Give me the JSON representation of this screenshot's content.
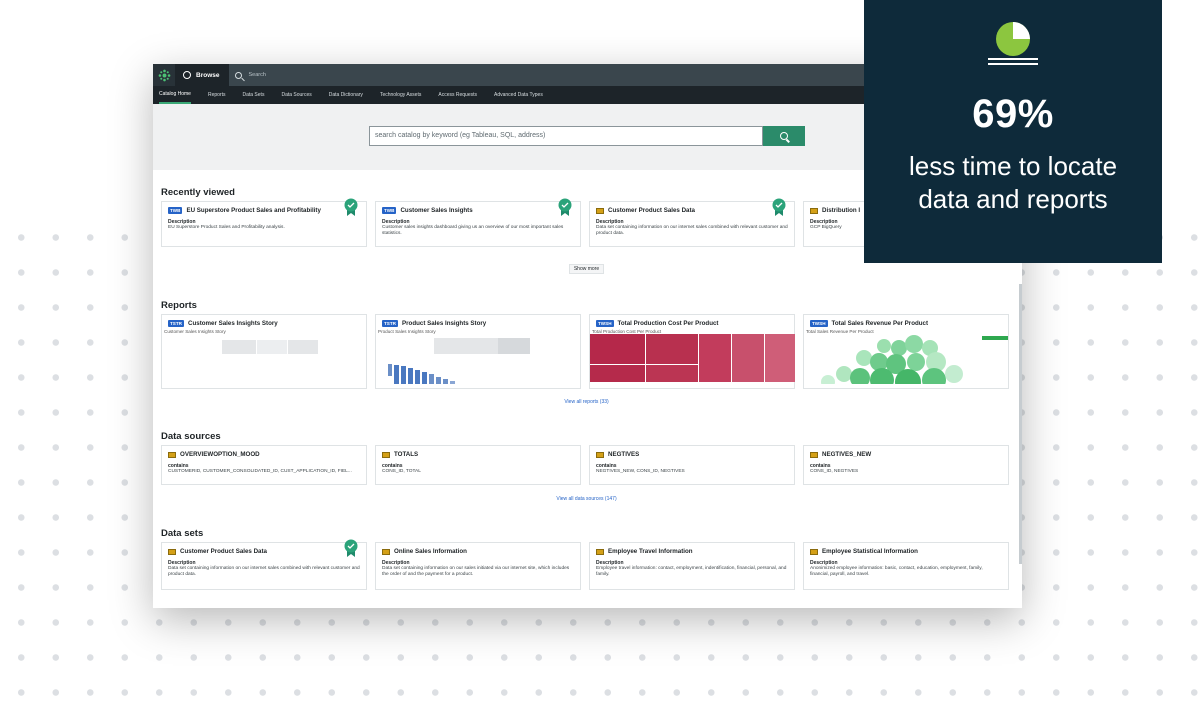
{
  "promo": {
    "stat": "69%",
    "caption_line1": "less time to locate",
    "caption_line2": "data and reports",
    "pie_color": "#8cc63f",
    "icon": "pie-chart-icon"
  },
  "app": {
    "browse_label": "Browse",
    "search_placeholder": "Search",
    "nav": [
      "Catalog Home",
      "Reports",
      "Data Sets",
      "Data Sources",
      "Data Dictionary",
      "Technology Assets",
      "Access Requests",
      "Advanced Data Types"
    ],
    "catalog_search_placeholder": "search catalog by keyword (eg Tableau, SQL, address)",
    "accent": "#2b8b6a"
  },
  "recently_viewed": {
    "title": "Recently viewed",
    "items": [
      {
        "tag": "TWB",
        "name": "EU Superstore Product Sales and Profitability",
        "label": "Description",
        "desc": "EU Superstore Product Sales and Profitability analysis."
      },
      {
        "tag": "TWB",
        "name": "Customer Sales Insights",
        "label": "Description",
        "desc": "Customer sales insights dashboard giving us an overview of our most important sales statistics."
      },
      {
        "tag": "",
        "name": "Customer Product Sales Data",
        "label": "Description",
        "desc": "Data set containing information on our internet sales combined with relevant customer and product data."
      },
      {
        "tag": "",
        "name": "Distribution I",
        "label": "Description",
        "desc": "GCP BigQuery"
      }
    ],
    "show_more": "Show more"
  },
  "reports": {
    "title": "Reports",
    "items": [
      {
        "tag": "TSTR",
        "name": "Customer Sales Insights Story",
        "sub": "Customer Sales Insights Story"
      },
      {
        "tag": "TSTR",
        "name": "Product Sales Insights Story",
        "sub": "Product Sales Insights Story"
      },
      {
        "tag": "TWSH",
        "name": "Total Production Cost Per Product",
        "sub": "Total Production Cost Per Product"
      },
      {
        "tag": "TWSH",
        "name": "Total Sales Revenue Per Product",
        "sub": "Total Sales Revenue Per Product"
      }
    ],
    "view_all": "View all reports (33)"
  },
  "data_sources": {
    "title": "Data sources",
    "items": [
      {
        "name": "OVERVIEWOPTION_MOOD",
        "label": "contains",
        "desc": "CUSTOMERID, CUSTOMER_CONSOLIDATED_ID, CUST_APPLICATION_ID, FIEL..."
      },
      {
        "name": "TOTALS",
        "label": "contains",
        "desc": "CONS_ID, TOTAL"
      },
      {
        "name": "NEGTIVES",
        "label": "contains",
        "desc": "NEGTIVES_NEW, CONS_ID, NEGTIVES"
      },
      {
        "name": "NEGTIVES_NEW",
        "label": "contains",
        "desc": "CONS_ID, NEGTIVES"
      }
    ],
    "view_all": "View all data sources (147)"
  },
  "data_sets": {
    "title": "Data sets",
    "items": [
      {
        "name": "Customer Product Sales Data",
        "label": "Description",
        "desc": "Data set containing information on our internet sales combined with relevant customer and product data."
      },
      {
        "name": "Online Sales Information",
        "label": "Description",
        "desc": "Data set containing information on our sales initiated via our internet site, which includes the order of and the payment for a product."
      },
      {
        "name": "Employee Travel Information",
        "label": "Description",
        "desc": "Employee travel information: contact, employment, indentification, financial, personal, and family."
      },
      {
        "name": "Employee Statistical Information",
        "label": "Description",
        "desc": "Anonimized employee information: basic, contact, education, employment, family, financial, payroll, and travel."
      }
    ]
  }
}
